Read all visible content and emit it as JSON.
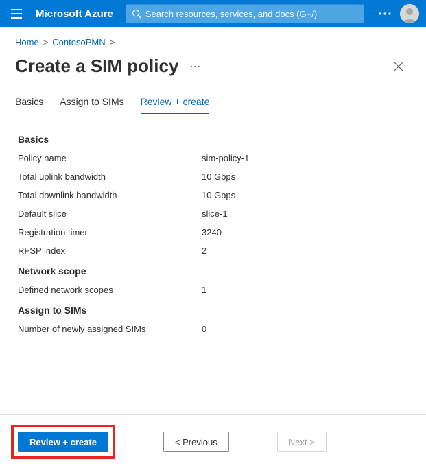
{
  "header": {
    "brand": "Microsoft Azure",
    "search_placeholder": "Search resources, services, and docs (G+/)"
  },
  "breadcrumb": {
    "home": "Home",
    "item": "ContosoPMN"
  },
  "page": {
    "title": "Create a SIM policy"
  },
  "tabs": {
    "basics": "Basics",
    "assign": "Assign to SIMs",
    "review": "Review + create"
  },
  "sections": {
    "basics": {
      "heading": "Basics",
      "policy_name_label": "Policy name",
      "policy_name_value": "sim-policy-1",
      "uplink_label": "Total uplink bandwidth",
      "uplink_value": "10 Gbps",
      "downlink_label": "Total downlink bandwidth",
      "downlink_value": "10 Gbps",
      "default_slice_label": "Default slice",
      "default_slice_value": "slice-1",
      "reg_timer_label": "Registration timer",
      "reg_timer_value": "3240",
      "rfsp_label": "RFSP index",
      "rfsp_value": "2"
    },
    "network_scope": {
      "heading": "Network scope",
      "defined_label": "Defined network scopes",
      "defined_value": "1"
    },
    "assign": {
      "heading": "Assign to SIMs",
      "newly_assigned_label": "Number of newly assigned SIMs",
      "newly_assigned_value": "0"
    }
  },
  "footer": {
    "review_create": "Review + create",
    "previous": "< Previous",
    "next": "Next >"
  }
}
